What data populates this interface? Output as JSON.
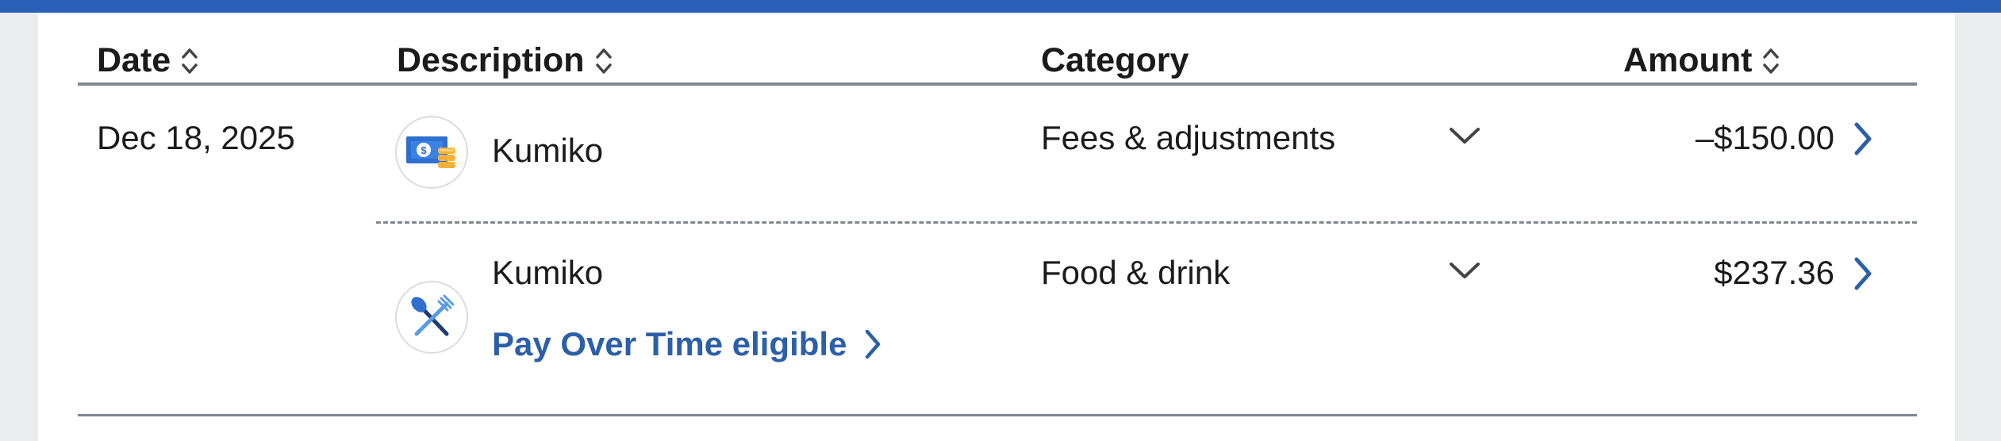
{
  "table": {
    "headers": {
      "date": "Date",
      "description": "Description",
      "category": "Category",
      "amount": "Amount"
    },
    "rows": [
      {
        "date": "Dec 18, 2025",
        "description": "Kumiko",
        "category": "Fees & adjustments",
        "amount": "–$150.00",
        "icon": "cash-fee-icon"
      },
      {
        "date": "",
        "description": "Kumiko",
        "category": "Food & drink",
        "amount": "$237.36",
        "icon": "fork-spoon-icon",
        "link": "Pay Over Time eligible"
      }
    ]
  },
  "colors": {
    "accent": "#2a5fb5",
    "link": "#2c5fa8",
    "rule": "#7f8790"
  }
}
